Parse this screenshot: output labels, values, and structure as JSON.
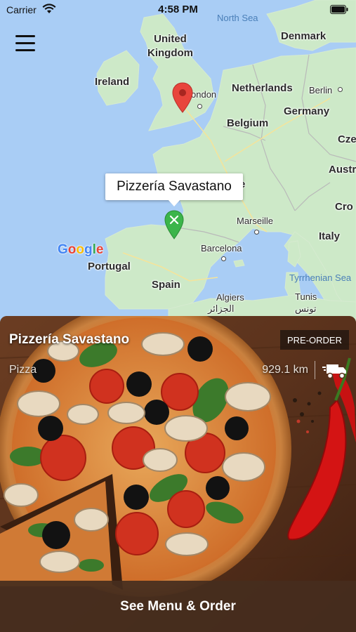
{
  "status_bar": {
    "carrier": "Carrier",
    "time": "4:58 PM"
  },
  "map": {
    "countries": [
      {
        "name": "United\nKingdom",
        "key": "uk"
      },
      {
        "name": "Ireland",
        "key": "ireland"
      },
      {
        "name": "Denmark",
        "key": "denmark"
      },
      {
        "name": "Netherlands",
        "key": "netherlands"
      },
      {
        "name": "Germany",
        "key": "germany"
      },
      {
        "name": "Belgium",
        "key": "belgium"
      },
      {
        "name": "Cze",
        "key": "czech"
      },
      {
        "name": "Austr",
        "key": "austria"
      },
      {
        "name": "Cro",
        "key": "croatia"
      },
      {
        "name": "Italy",
        "key": "italy"
      },
      {
        "name": "Portugal",
        "key": "portugal"
      },
      {
        "name": "Spain",
        "key": "spain"
      }
    ],
    "cities": {
      "london": "ondon",
      "berlin": "Berlin",
      "marseille": "Marseille",
      "barcelona": "Barcelona",
      "algiers": "Algiers",
      "algiers_ar": "الجزائر",
      "tunis": "Tunis",
      "tunis_ar": "تونس",
      "france_fragment": "e"
    },
    "seas": {
      "north": "North Sea",
      "tyrrhenian": "Tyrrhenian Sea"
    },
    "attribution": "Google",
    "callout": "Pizzería Savastano"
  },
  "restaurant": {
    "name": "Pizzería Savastano",
    "badge": "PRE-ORDER",
    "category": "Pizza",
    "distance": "929.1 km"
  },
  "cta": {
    "label": "See Menu & Order"
  },
  "colors": {
    "sea": "#a9cdf5",
    "land": "#cde9c8",
    "pin_red": "#e8453c",
    "pin_green": "#3bb54a",
    "cta_bg": "#462d1e"
  },
  "icons": [
    "wifi-icon",
    "battery-icon",
    "hamburger-icon",
    "map-pin-icon",
    "delivery-truck-icon"
  ]
}
